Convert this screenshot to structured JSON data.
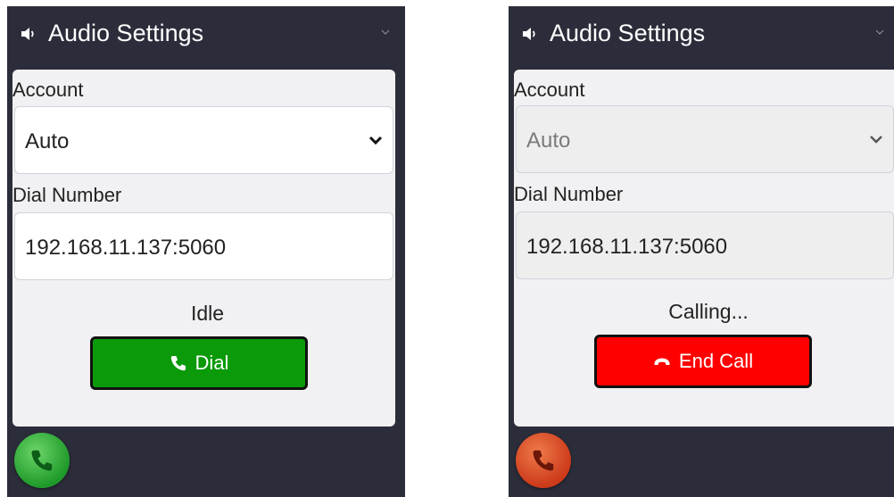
{
  "panels": [
    {
      "header": {
        "title": "Audio Settings"
      },
      "account": {
        "label": "Account",
        "value": "Auto"
      },
      "dial_number": {
        "label": "Dial Number",
        "value": "192.168.11.137:5060"
      },
      "status": "Idle",
      "button": {
        "label": "Dial",
        "color": "#0a9a0a"
      },
      "fab": {
        "state": "idle",
        "color": "#1f9a2a"
      }
    },
    {
      "header": {
        "title": "Audio Settings"
      },
      "account": {
        "label": "Account",
        "value": "Auto"
      },
      "dial_number": {
        "label": "Dial Number",
        "value": "192.168.11.137:5060"
      },
      "status": "Calling...",
      "button": {
        "label": "End Call",
        "color": "#ff0000"
      },
      "fab": {
        "state": "calling",
        "color": "#cc3a1a"
      }
    }
  ],
  "icons": {
    "speaker": "speaker-icon",
    "collapse": "chevron-down-icon",
    "select_arrow": "chevron-down-icon",
    "phone": "phone-icon",
    "hangup": "phone-hangup-icon"
  },
  "colors": {
    "panel_bg": "#2b2d3a",
    "card_bg": "#f1f1f3"
  }
}
